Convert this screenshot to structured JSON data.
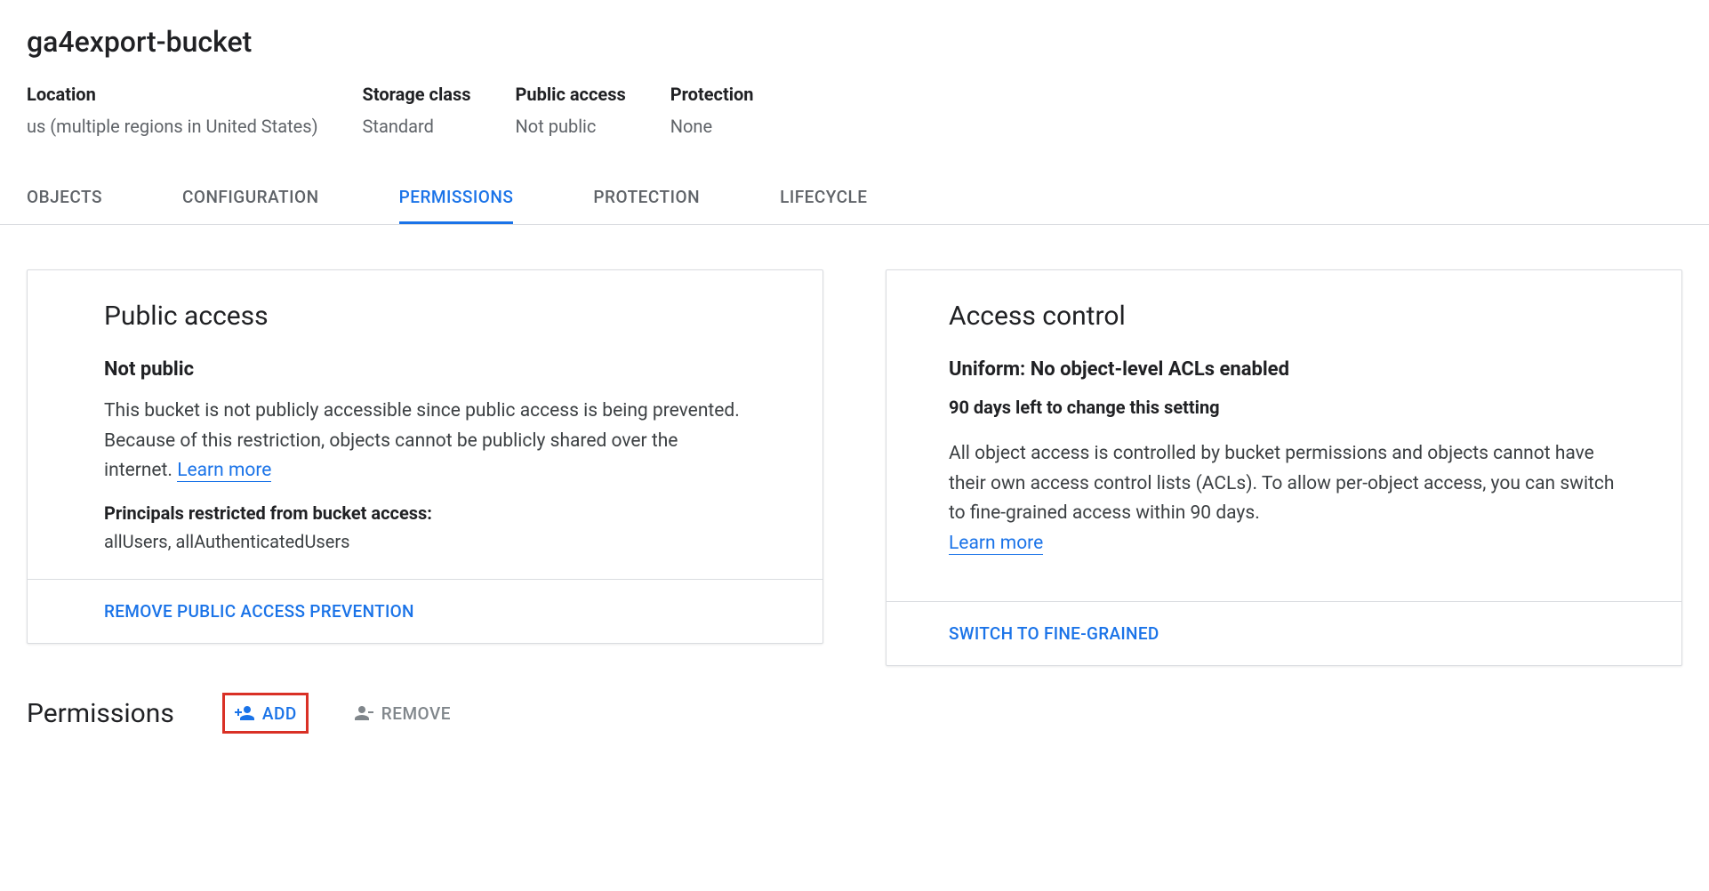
{
  "bucket": {
    "name": "ga4export-bucket",
    "meta": {
      "location": {
        "label": "Location",
        "value": "us (multiple regions in United States)"
      },
      "storage_class": {
        "label": "Storage class",
        "value": "Standard"
      },
      "public_access": {
        "label": "Public access",
        "value": "Not public"
      },
      "protection": {
        "label": "Protection",
        "value": "None"
      }
    }
  },
  "tabs": {
    "objects": "OBJECTS",
    "configuration": "CONFIGURATION",
    "permissions": "PERMISSIONS",
    "protection": "PROTECTION",
    "lifecycle": "LIFECYCLE"
  },
  "public_access_card": {
    "title": "Public access",
    "status": "Not public",
    "description": "This bucket is not publicly accessible since public access is being prevented. Because of this restriction, objects cannot be publicly shared over the internet. ",
    "learn_more": "Learn more",
    "restricted_label": "Principals restricted from bucket access:",
    "restricted_value": "allUsers, allAuthenticatedUsers",
    "action": "REMOVE PUBLIC ACCESS PREVENTION"
  },
  "access_control_card": {
    "title": "Access control",
    "subtitle": "Uniform: No object-level ACLs enabled",
    "days_left": "90 days left to change this setting",
    "description": "All object access is controlled by bucket permissions and objects cannot have their own access control lists (ACLs). To allow per-object access, you can switch to fine-grained access within 90 days. ",
    "learn_more": "Learn more",
    "action": "SWITCH TO FINE-GRAINED"
  },
  "permissions": {
    "title": "Permissions",
    "add": "ADD",
    "remove": "REMOVE"
  }
}
